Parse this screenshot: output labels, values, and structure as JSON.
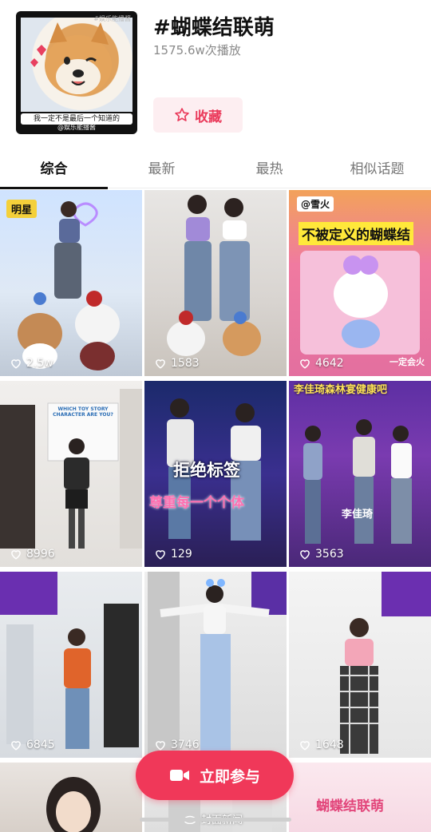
{
  "header": {
    "topic_title": "#蝴蝶结联萌",
    "play_count": "1575.6w次播放",
    "collect_label": "收藏",
    "cover": {
      "top_text": "#娱乐能播酱",
      "caption": "我一定不是最后一个知道的",
      "logo_text": "@娱乐能播酱"
    }
  },
  "tabs": [
    {
      "label": "综合",
      "active": true
    },
    {
      "label": "最新",
      "active": false
    },
    {
      "label": "最热",
      "active": false
    },
    {
      "label": "相似话题",
      "active": false
    }
  ],
  "videos": [
    {
      "likes": "2.5w",
      "badge": "明星"
    },
    {
      "likes": "1583"
    },
    {
      "likes": "4642",
      "overlay_top": "@雪火",
      "overlay_title": "不被定义的蝴蝶结",
      "overlay_bottom": "一定会火"
    },
    {
      "likes": "8996",
      "poster_text": "WHICH TOY STORY CHARACTER ARE YOU?"
    },
    {
      "likes": "129",
      "overlay_title": "拒绝标签",
      "overlay_sub": "尊重每一个个体"
    },
    {
      "likes": "3563",
      "overlay_top": "李佳琦森林宴健康吧",
      "overlay_bottom": "李佳琦"
    },
    {
      "likes": "6845"
    },
    {
      "likes": "3746"
    },
    {
      "likes": "1648"
    },
    {
      "likes": ""
    },
    {
      "likes": ""
    },
    {
      "likes": "",
      "overlay_title": "蝴蝶结联萌"
    }
  ],
  "join_button_label": "立即参与",
  "watermark": "封面新闻",
  "colors": {
    "accent": "#f03859",
    "collect_bg": "#fdeef1",
    "collect_text": "#ea3a5b",
    "badge": "#f4d03a"
  }
}
